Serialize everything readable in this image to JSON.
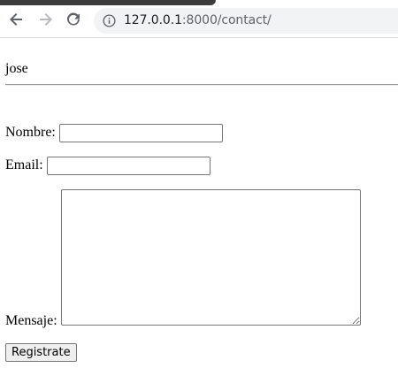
{
  "browser": {
    "url_host": "127.0.0.1",
    "url_path": ":8000/contact/",
    "icons": {
      "back": "arrow-left-icon",
      "forward": "arrow-right-icon",
      "reload": "reload-icon",
      "site_info": "info-icon"
    }
  },
  "page": {
    "user": "jose",
    "form": {
      "nombre_label": "Nombre:",
      "nombre_value": "",
      "email_label": "Email:",
      "email_value": "",
      "mensaje_label": "Mensaje:",
      "mensaje_value": "",
      "submit_label": "Registrate"
    }
  }
}
